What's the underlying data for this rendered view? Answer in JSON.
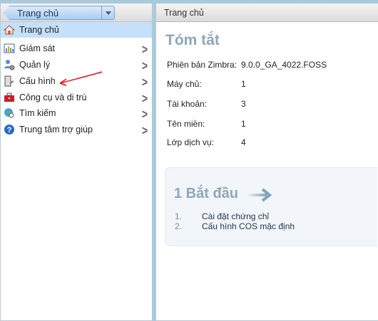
{
  "breadcrumb": {
    "label": "Trang chủ"
  },
  "nav": [
    {
      "label": "Trang chủ",
      "icon": "home-icon",
      "selected": true
    },
    {
      "label": "Giám sát",
      "icon": "monitor-chart-icon"
    },
    {
      "label": "Quản lý",
      "icon": "manage-users-icon"
    },
    {
      "label": "Cấu hình",
      "icon": "configure-icon"
    },
    {
      "label": "Công cụ và di trú",
      "icon": "toolbox-icon"
    },
    {
      "label": "Tìm kiếm",
      "icon": "search-globe-icon"
    },
    {
      "label": "Trung tâm trợ giúp",
      "icon": "help-icon"
    }
  ],
  "main": {
    "header": "Trang chủ",
    "title": "Tóm tắt",
    "summary": [
      {
        "label": "Phiên bản Zimbra:",
        "value": "9.0.0_GA_4022.FOSS"
      },
      {
        "label": "Máy chủ:",
        "value": "1"
      },
      {
        "label": "Tài khoản:",
        "value": "3"
      },
      {
        "label": "Tên miền:",
        "value": "1"
      },
      {
        "label": "Lớp dịch vụ:",
        "value": "4"
      }
    ],
    "getting_started": {
      "title": "1 Bắt đầu",
      "steps": [
        {
          "n": "1.",
          "label": "Cài đặt chứng chỉ"
        },
        {
          "n": "2.",
          "label": "Cấu hình COS mặc định"
        }
      ]
    }
  },
  "colors": {
    "selected": "#c6e0fb",
    "title": "#8fa6ba",
    "annotation": "#e8101a"
  }
}
